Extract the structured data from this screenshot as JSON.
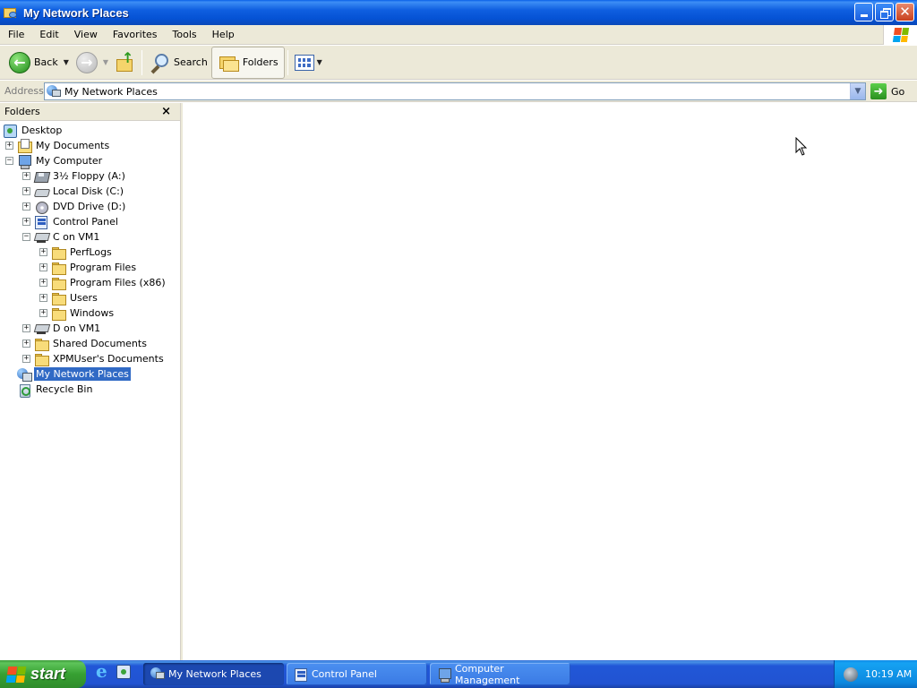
{
  "window": {
    "title": "My Network Places"
  },
  "menu": {
    "items": [
      "File",
      "Edit",
      "View",
      "Favorites",
      "Tools",
      "Help"
    ]
  },
  "toolbar": {
    "back_label": "Back",
    "search_label": "Search",
    "folders_label": "Folders"
  },
  "address": {
    "label": "Address",
    "value": "My Network Places",
    "go_label": "Go"
  },
  "folders_pane": {
    "title": "Folders",
    "close_glyph": "×",
    "tree": [
      {
        "label": "Desktop",
        "icon": "desktop-icon",
        "expander": "none",
        "selected": false
      },
      {
        "label": "My Documents",
        "icon": "my-documents-icon",
        "expander": "+",
        "selected": false
      },
      {
        "label": "My Computer",
        "icon": "my-computer-icon",
        "expander": "−",
        "selected": false
      },
      {
        "label": "3½ Floppy (A:)",
        "icon": "floppy-drive-icon",
        "expander": "+",
        "selected": false
      },
      {
        "label": "Local Disk (C:)",
        "icon": "local-disk-icon",
        "expander": "+",
        "selected": false
      },
      {
        "label": "DVD Drive (D:)",
        "icon": "dvd-drive-icon",
        "expander": "+",
        "selected": false
      },
      {
        "label": "Control Panel",
        "icon": "control-panel-icon",
        "expander": "+",
        "selected": false
      },
      {
        "label": "C on VM1",
        "icon": "network-drive-icon",
        "expander": "−",
        "selected": false
      },
      {
        "label": "PerfLogs",
        "icon": "folder-icon",
        "expander": "+",
        "selected": false
      },
      {
        "label": "Program Files",
        "icon": "folder-icon",
        "expander": "+",
        "selected": false
      },
      {
        "label": "Program Files (x86)",
        "icon": "folder-icon",
        "expander": "+",
        "selected": false
      },
      {
        "label": "Users",
        "icon": "folder-icon",
        "expander": "+",
        "selected": false
      },
      {
        "label": "Windows",
        "icon": "folder-icon",
        "expander": "+",
        "selected": false
      },
      {
        "label": "D on VM1",
        "icon": "network-drive-icon",
        "expander": "+",
        "selected": false
      },
      {
        "label": "Shared Documents",
        "icon": "folder-icon",
        "expander": "+",
        "selected": false
      },
      {
        "label": "XPMUser's Documents",
        "icon": "folder-icon",
        "expander": "+",
        "selected": false
      },
      {
        "label": "My Network Places",
        "icon": "network-places-icon",
        "expander": "none",
        "selected": true
      },
      {
        "label": "Recycle Bin",
        "icon": "recycle-bin-icon",
        "expander": "none",
        "selected": false
      }
    ]
  },
  "taskbar": {
    "start_label": "start",
    "tasks": [
      {
        "label": "My Network Places",
        "active": true
      },
      {
        "label": "Control Panel",
        "active": false
      },
      {
        "label": "Computer Management",
        "active": false
      }
    ],
    "clock": "10:19 AM"
  },
  "colors": {
    "titlebar_blue": "#0552d4",
    "selection_blue": "#316ac5",
    "chrome_beige": "#ece9d8",
    "start_green": "#37a032"
  }
}
